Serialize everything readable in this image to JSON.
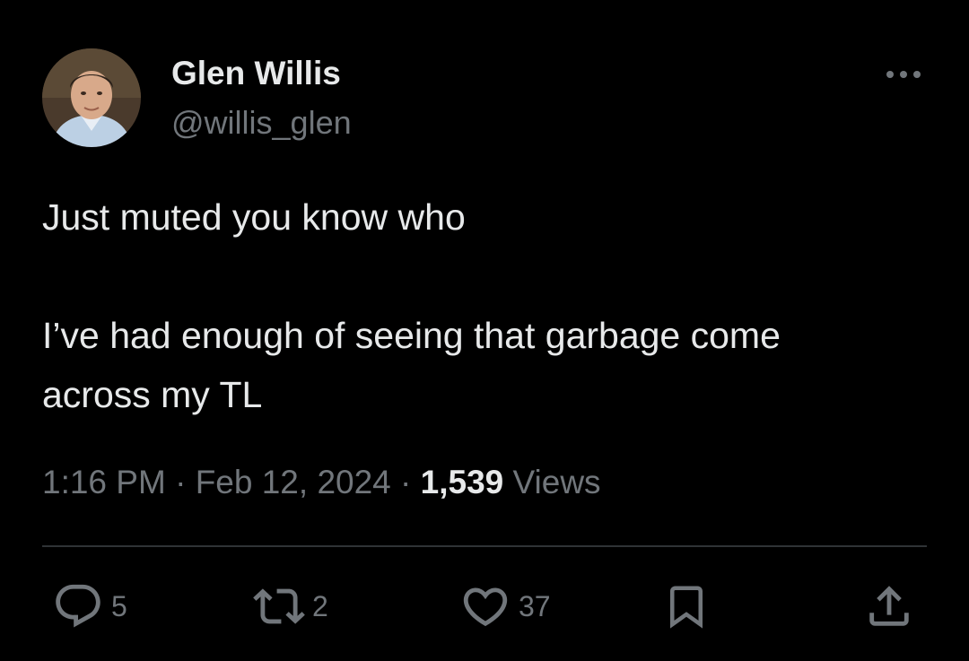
{
  "author": {
    "name": "Glen Willis",
    "handle": "@willis_glen",
    "avatar_icon": "profile-photo-icon"
  },
  "tweet": {
    "line1": "Just muted you know who",
    "line2": "I’ve had enough of seeing that garbage come",
    "line3": "across my TL"
  },
  "meta": {
    "time": "1:16 PM",
    "sep1": " · ",
    "date": "Feb 12, 2024",
    "sep2": " · ",
    "views_count": "1,539",
    "views_label": " Views"
  },
  "actions": {
    "replies": "5",
    "reposts": "2",
    "likes": "37"
  },
  "colors": {
    "background": "#000000",
    "primary_text": "#e7e9ea",
    "secondary_text": "#71767b",
    "divider": "#2f3336"
  },
  "icons": {
    "more": "more-dots-icon",
    "reply": "reply-bubble-icon",
    "repost": "repost-arrows-icon",
    "like": "heart-icon",
    "bookmark": "bookmark-icon",
    "share": "share-upload-icon"
  }
}
